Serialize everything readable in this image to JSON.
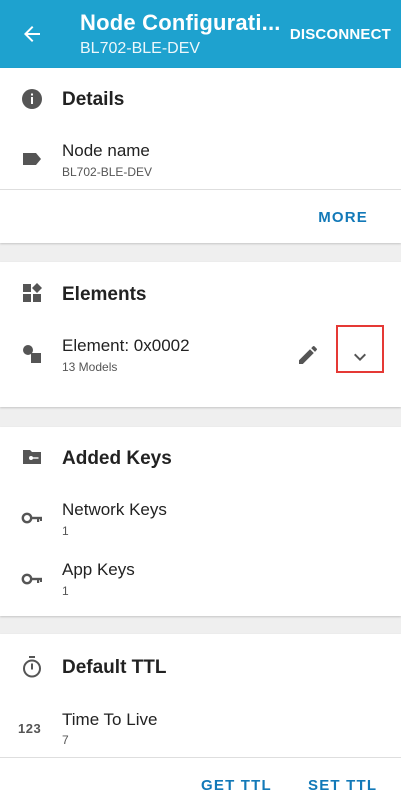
{
  "appbar": {
    "title": "Node Configurati...",
    "subtitle": "BL702-BLE-DEV",
    "disconnect_label": "DISCONNECT"
  },
  "details": {
    "title": "Details",
    "node_name_label": "Node name",
    "node_name_value": "BL702-BLE-DEV",
    "more_label": "MORE"
  },
  "elements": {
    "title": "Elements",
    "element_label": "Element: 0x0002",
    "element_sub": "13 Models"
  },
  "keys": {
    "title": "Added Keys",
    "network_label": "Network Keys",
    "network_count": "1",
    "app_label": "App Keys",
    "app_count": "1"
  },
  "ttl": {
    "title": "Default TTL",
    "ttl_label": "Time To Live",
    "ttl_value": "7",
    "get_label": "GET TTL",
    "set_label": "SET TTL"
  },
  "colors": {
    "appbar": "#1ea2cf",
    "accent": "#1279b8",
    "highlight": "#e53935"
  },
  "icons": {
    "back": "arrow-left-icon",
    "details": "info-icon",
    "node_name": "label-tag-icon",
    "elements": "widgets-icon",
    "element_row": "element-shapes-icon",
    "edit": "pencil-icon",
    "expand": "chevron-down-icon",
    "keys": "folder-key-icon",
    "key": "key-icon",
    "ttl": "timer-icon",
    "numeric": "numeric-123-icon"
  }
}
